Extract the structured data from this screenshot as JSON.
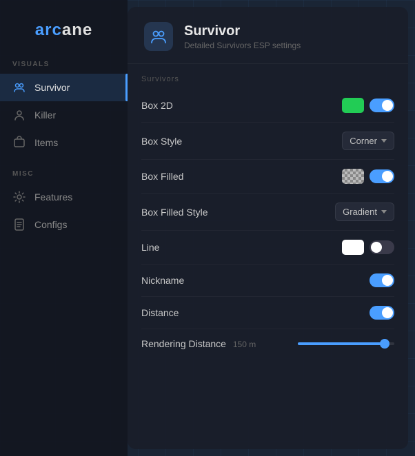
{
  "app": {
    "logo_arc": "arc",
    "logo_ane": "ane"
  },
  "sidebar": {
    "visuals_label": "VISUALS",
    "misc_label": "MISC",
    "items": [
      {
        "id": "survivor",
        "label": "Survivor",
        "active": true
      },
      {
        "id": "killer",
        "label": "Killer",
        "active": false
      },
      {
        "id": "items",
        "label": "Items",
        "active": false
      },
      {
        "id": "features",
        "label": "Features",
        "active": false
      },
      {
        "id": "configs",
        "label": "Configs",
        "active": false
      }
    ]
  },
  "main": {
    "header_title": "Survivor",
    "header_subtitle": "Detailed Survivors ESP settings",
    "section_title": "Survivors",
    "rows": [
      {
        "id": "box2d",
        "label": "Box 2D",
        "type": "color_toggle",
        "color": "green",
        "toggle": "on"
      },
      {
        "id": "box_style",
        "label": "Box Style",
        "type": "dropdown",
        "value": "Corner"
      },
      {
        "id": "box_filled",
        "label": "Box Filled",
        "type": "color_toggle",
        "color": "checker",
        "toggle": "on"
      },
      {
        "id": "box_filled_style",
        "label": "Box Filled Style",
        "type": "dropdown",
        "value": "Gradient"
      },
      {
        "id": "line",
        "label": "Line",
        "type": "color_toggle",
        "color": "white",
        "toggle": "off"
      },
      {
        "id": "nickname",
        "label": "Nickname",
        "type": "toggle",
        "toggle": "on"
      },
      {
        "id": "distance",
        "label": "Distance",
        "type": "toggle",
        "toggle": "on"
      },
      {
        "id": "rendering_distance",
        "label": "Rendering Distance",
        "type": "slider",
        "slider_value": "150 m",
        "slider_percent": 90
      }
    ]
  }
}
